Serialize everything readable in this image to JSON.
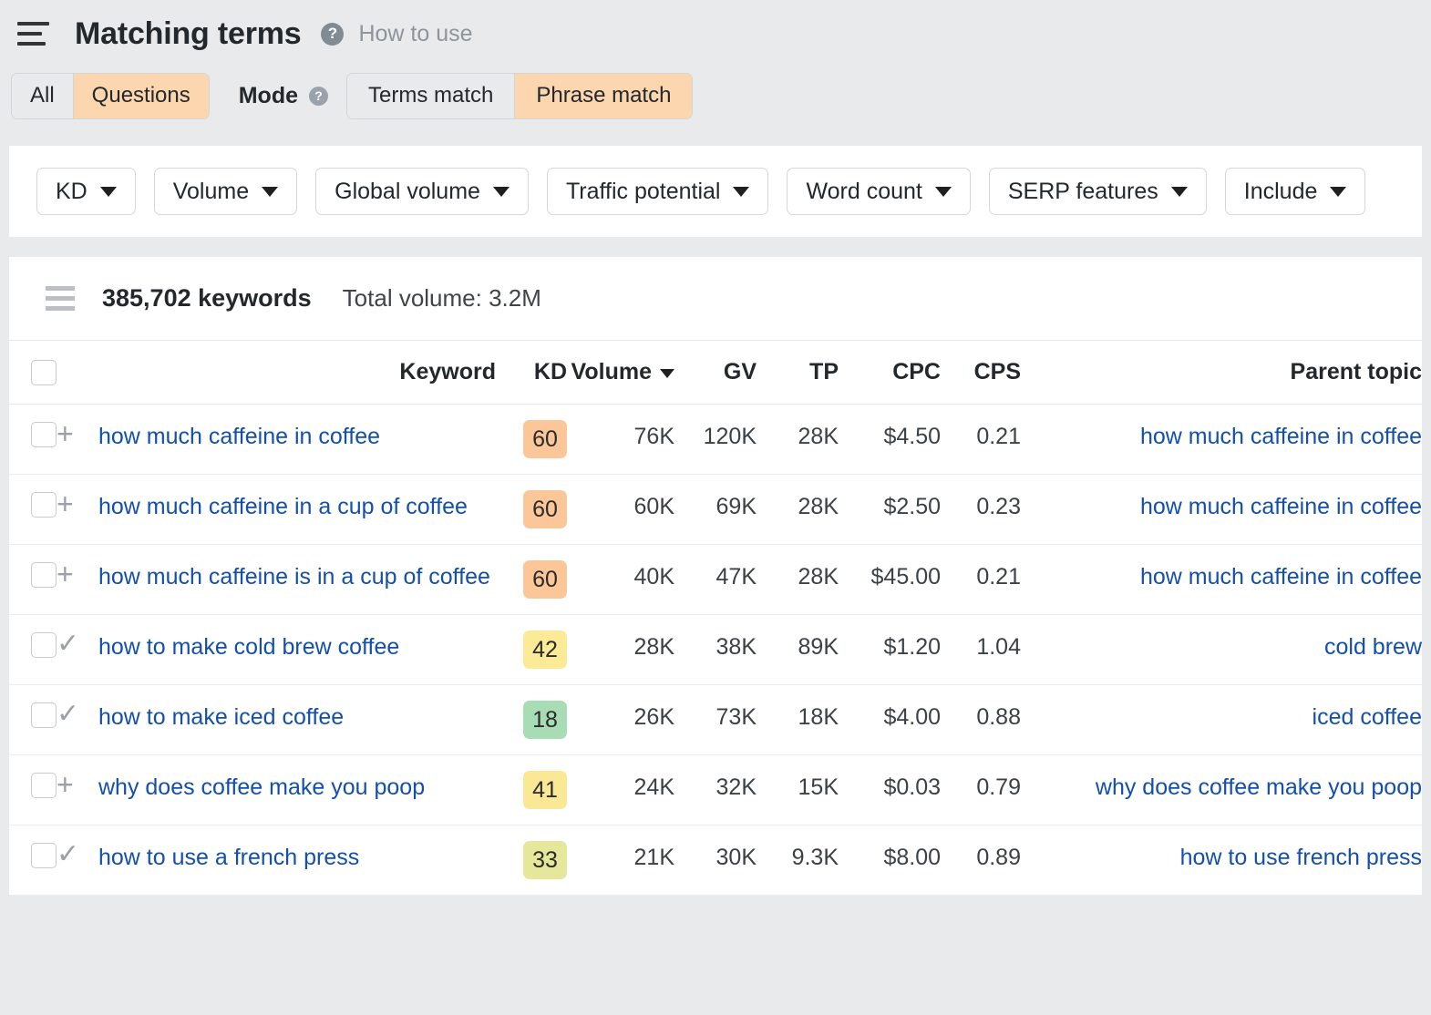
{
  "header": {
    "menu_icon": "hamburger-icon",
    "title": "Matching terms",
    "help_icon": "question-mark-icon",
    "how_to_use": "How to use"
  },
  "filters_top": {
    "scope_tabs": [
      {
        "label": "All",
        "active": false
      },
      {
        "label": "Questions",
        "active": true
      }
    ],
    "mode_label": "Mode",
    "mode_help_icon": "question-mark-icon",
    "mode_tabs": [
      {
        "label": "Terms match",
        "active": false
      },
      {
        "label": "Phrase match",
        "active": true
      }
    ]
  },
  "filter_bar": {
    "buttons": [
      {
        "label": "KD"
      },
      {
        "label": "Volume"
      },
      {
        "label": "Global volume"
      },
      {
        "label": "Traffic potential"
      },
      {
        "label": "Word count"
      },
      {
        "label": "SERP features"
      },
      {
        "label": "Include"
      }
    ]
  },
  "summary": {
    "list_icon": "list-lines-icon",
    "keyword_count": "385,702 keywords",
    "total_volume": "Total volume: 3.2M"
  },
  "table": {
    "columns": [
      {
        "key": "keyword",
        "label": "Keyword"
      },
      {
        "key": "kd",
        "label": "KD"
      },
      {
        "key": "volume",
        "label": "Volume",
        "sorted": true
      },
      {
        "key": "gv",
        "label": "GV"
      },
      {
        "key": "tp",
        "label": "TP"
      },
      {
        "key": "cpc",
        "label": "CPC"
      },
      {
        "key": "cps",
        "label": "CPS"
      },
      {
        "key": "parent_topic",
        "label": "Parent topic"
      }
    ],
    "rows": [
      {
        "icon": "plus-icon",
        "keyword": "how much caffeine in coffee",
        "kd": "60",
        "kd_color": "#fbc799",
        "volume": "76K",
        "gv": "120K",
        "tp": "28K",
        "cpc": "$4.50",
        "cps": "0.21",
        "parent_topic": "how much caffeine in coffee"
      },
      {
        "icon": "plus-icon",
        "keyword": "how much caffeine in a cup of coffee",
        "kd": "60",
        "kd_color": "#fbc799",
        "volume": "60K",
        "gv": "69K",
        "tp": "28K",
        "cpc": "$2.50",
        "cps": "0.23",
        "parent_topic": "how much caffeine in coffee"
      },
      {
        "icon": "plus-icon",
        "keyword": "how much caffeine is in a cup of coffee",
        "kd": "60",
        "kd_color": "#fbc799",
        "volume": "40K",
        "gv": "47K",
        "tp": "28K",
        "cpc": "$45.00",
        "cps": "0.21",
        "parent_topic": "how much caffeine in coffee"
      },
      {
        "icon": "check-icon",
        "keyword": "how to make cold brew coffee",
        "kd": "42",
        "kd_color": "#fbeb96",
        "volume": "28K",
        "gv": "38K",
        "tp": "89K",
        "cpc": "$1.20",
        "cps": "1.04",
        "parent_topic": "cold brew"
      },
      {
        "icon": "check-icon",
        "keyword": "how to make iced coffee",
        "kd": "18",
        "kd_color": "#a8dcb4",
        "volume": "26K",
        "gv": "73K",
        "tp": "18K",
        "cpc": "$4.00",
        "cps": "0.88",
        "parent_topic": "iced coffee"
      },
      {
        "icon": "plus-icon",
        "keyword": "why does coffee make you poop",
        "kd": "41",
        "kd_color": "#fbe894",
        "volume": "24K",
        "gv": "32K",
        "tp": "15K",
        "cpc": "$0.03",
        "cps": "0.79",
        "parent_topic": "why does coffee make you poop"
      },
      {
        "icon": "check-icon",
        "keyword": "how to use a french press",
        "kd": "33",
        "kd_color": "#e5e79b",
        "volume": "21K",
        "gv": "30K",
        "tp": "9.3K",
        "cpc": "$8.00",
        "cps": "0.89",
        "parent_topic": "how to use french press"
      }
    ]
  },
  "colors": {
    "page_background": "#e9eaec",
    "card_background": "#ffffff",
    "link": "#134fab",
    "active_pill": "#fbd6ae"
  },
  "icon_glyphs": {
    "plus-icon": "+",
    "check-icon": "✓",
    "question-mark-icon": "?"
  }
}
